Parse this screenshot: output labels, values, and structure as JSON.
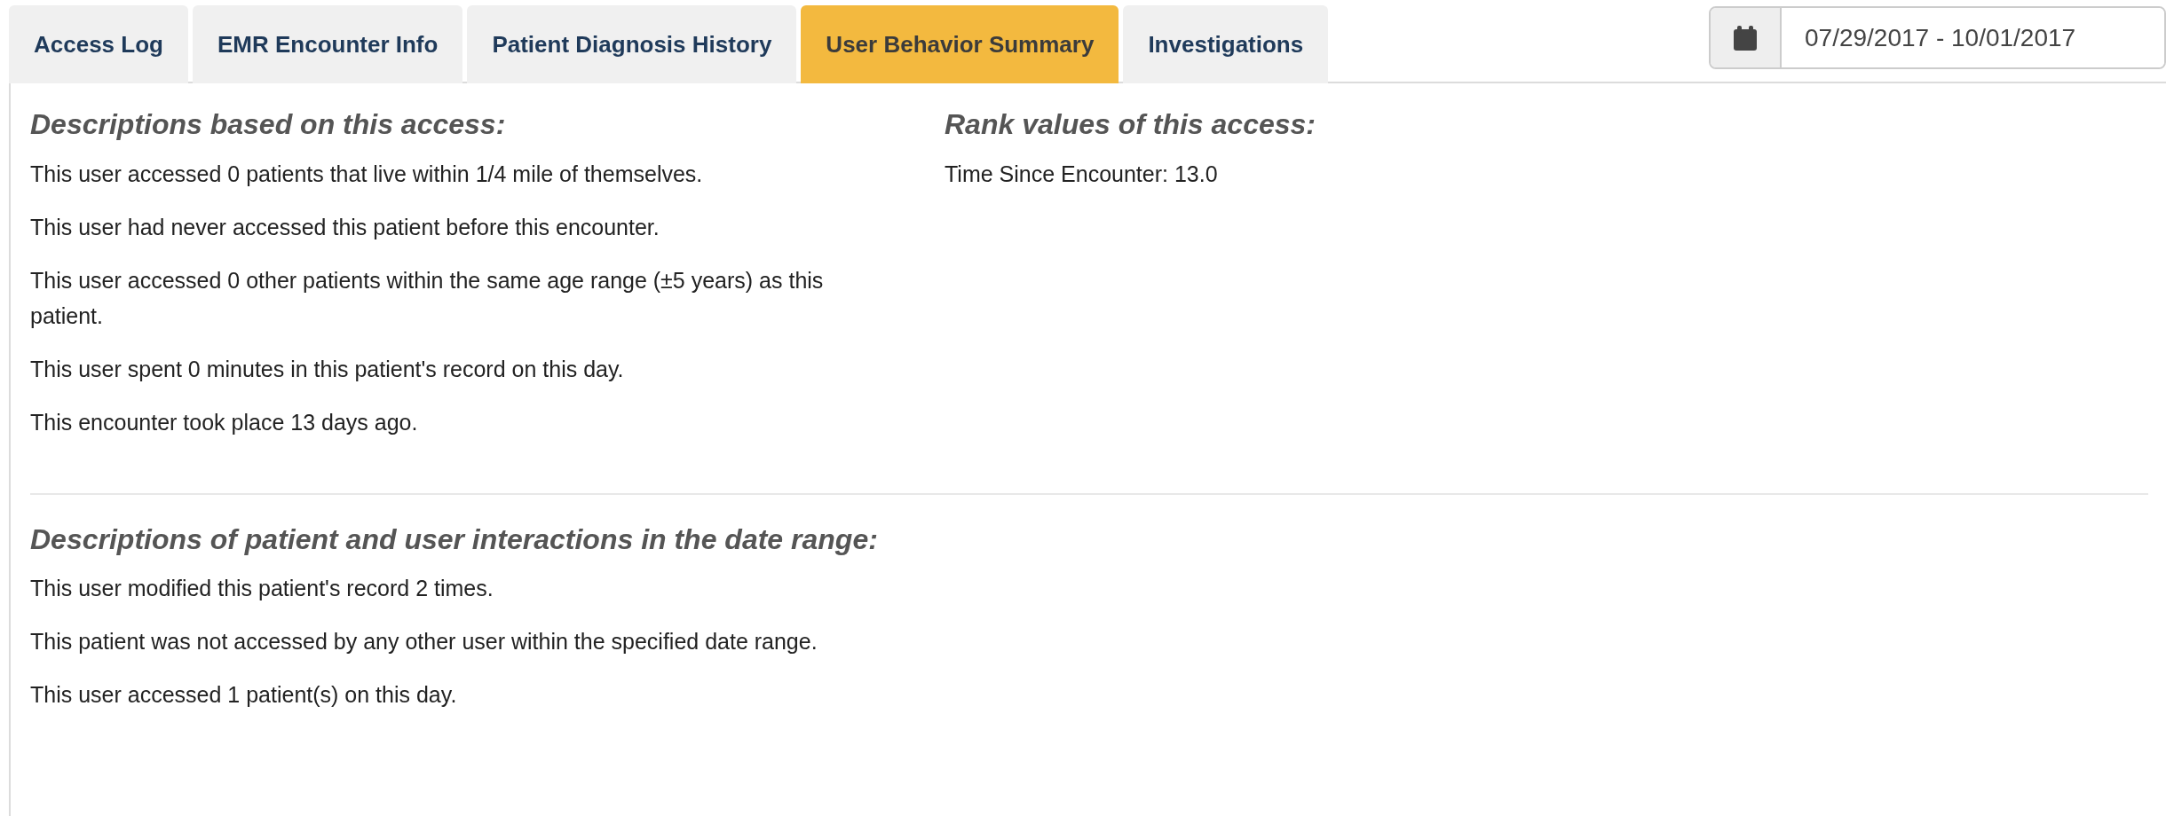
{
  "tabs": [
    {
      "label": "Access Log",
      "selected": false
    },
    {
      "label": "EMR Encounter Info",
      "selected": false
    },
    {
      "label": "Patient Diagnosis History",
      "selected": false
    },
    {
      "label": "User Behavior Summary",
      "selected": true
    },
    {
      "label": "Investigations",
      "selected": false
    }
  ],
  "date_range": {
    "value": "07/29/2017 - 10/01/2017"
  },
  "access_section": {
    "descriptions": {
      "heading": "Descriptions based on this access:",
      "lines": [
        "This user accessed 0 patients that live within 1/4 mile of themselves.",
        "This user had never accessed this patient before this encounter.",
        "This user accessed 0 other patients within the same age range (±5 years) as this patient.",
        "This user spent 0 minutes in this patient's record on this day.",
        "This encounter took place 13 days ago."
      ]
    },
    "rank_values": {
      "heading": "Rank values of this access:",
      "lines": [
        "Time Since Encounter: 13.0"
      ]
    }
  },
  "interactions_section": {
    "heading": "Descriptions of patient and user interactions in the date range:",
    "lines": [
      "This user modified this patient's record 2 times.",
      "This patient was not accessed by any other user within the specified date range.",
      "This user accessed 1 patient(s) on this day."
    ]
  }
}
